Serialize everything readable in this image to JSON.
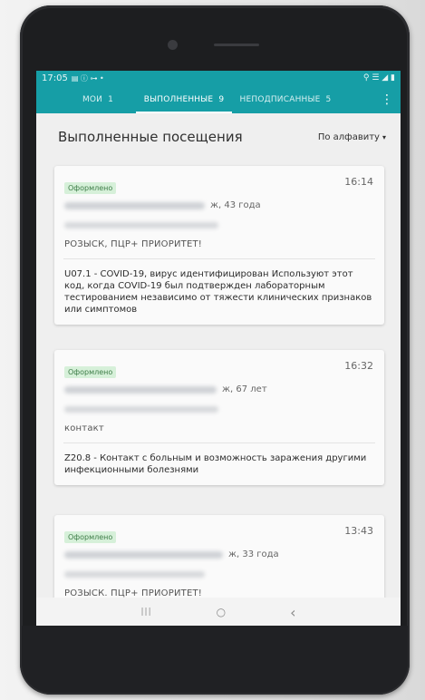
{
  "status_bar": {
    "time": "17:05",
    "left_icons": "▤ ⓘ ⊶ •",
    "right_icons": "⚲ ☰ ◢ ▮"
  },
  "tabs": [
    {
      "label": "МОИ",
      "count": "1"
    },
    {
      "label": "ВЫПОЛНЕННЫЕ",
      "count": "9"
    },
    {
      "label": "НЕПОДПИСАННЫЕ",
      "count": "5"
    }
  ],
  "menu_icon": "⋮",
  "page_title": "Выполненные посещения",
  "sort": {
    "label": "По алфавиту",
    "caret": "▾"
  },
  "cards": [
    {
      "badge": "Оформлено",
      "time": "16:14",
      "patient_info": "ж, 43 года",
      "reason": "РОЗЫСК, ПЦР+ ПРИОРИТЕТ!",
      "diagnosis": "U07.1 - COVID-19, вирус идентифицирован Используют этот код, когда COVID-19 был подтвержден лабораторным тестированием независимо от тяжести клинических признаков или симптомов"
    },
    {
      "badge": "Оформлено",
      "time": "16:32",
      "patient_info": "ж, 67 лет",
      "reason": "контакт",
      "diagnosis": "Z20.8 - Контакт с больным и возможность заражения другими инфекционными болезнями"
    },
    {
      "badge": "Оформлено",
      "time": "13:43",
      "patient_info": "ж, 33 года",
      "reason": "РОЗЫСК. ПЦР+ ПРИОРИТЕТ!",
      "diagnosis": ""
    }
  ],
  "nav": {
    "recents": "|||",
    "home": "○",
    "back": "‹"
  },
  "colors": {
    "accent": "#169ea6",
    "badge_bg": "#d6f0d9",
    "badge_text": "#3e7d48"
  }
}
